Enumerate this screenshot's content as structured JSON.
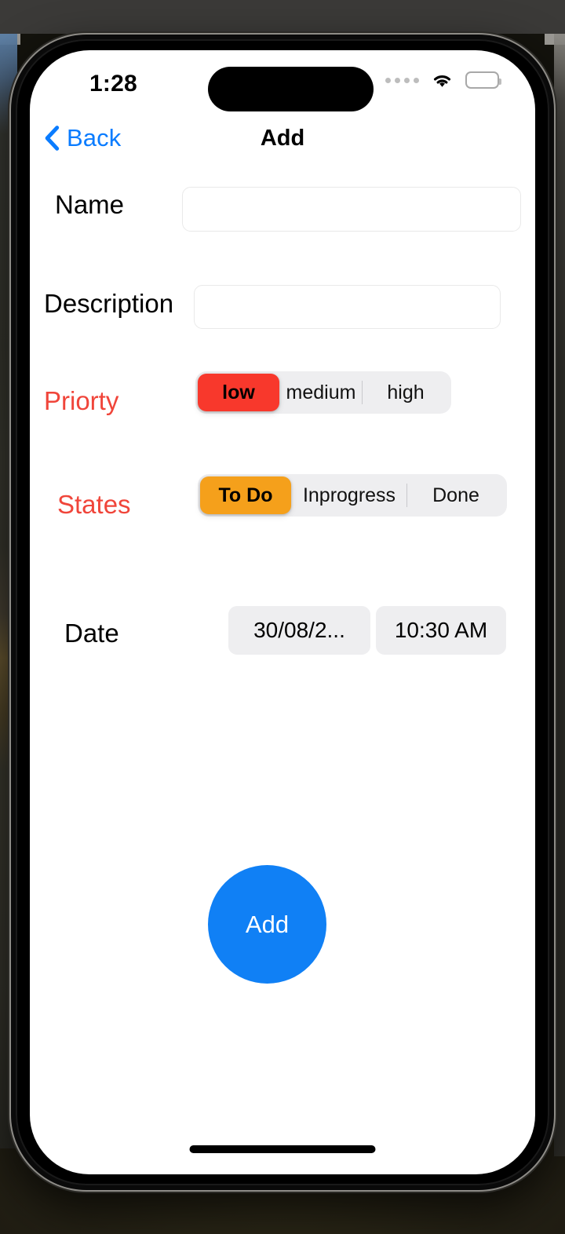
{
  "status_bar": {
    "time": "1:28",
    "signal_icon": "signal-dots-icon",
    "wifi_icon": "wifi-icon",
    "battery_icon": "battery-full-icon"
  },
  "nav": {
    "back_label": "Back",
    "back_icon": "chevron-left-icon",
    "title": "Add",
    "accent_color": "#0a7cff"
  },
  "form": {
    "name": {
      "label": "Name",
      "value": "",
      "placeholder": ""
    },
    "description": {
      "label": "Description",
      "value": "",
      "placeholder": ""
    },
    "priority": {
      "label": "Priorty",
      "label_color": "#f0453a",
      "selected": "low",
      "selected_color": "#f8382c",
      "options": [
        "low",
        "medium",
        "high"
      ]
    },
    "states": {
      "label": "States",
      "label_color": "#f0453a",
      "selected": "To Do",
      "selected_color": "#f5a01b",
      "options": [
        "To Do",
        "Inprogress",
        "Done"
      ]
    },
    "date": {
      "label": "Date",
      "date_value": "30/08/2...",
      "time_value": "10:30 AM"
    }
  },
  "actions": {
    "add_label": "Add",
    "add_color": "#1080f5"
  }
}
